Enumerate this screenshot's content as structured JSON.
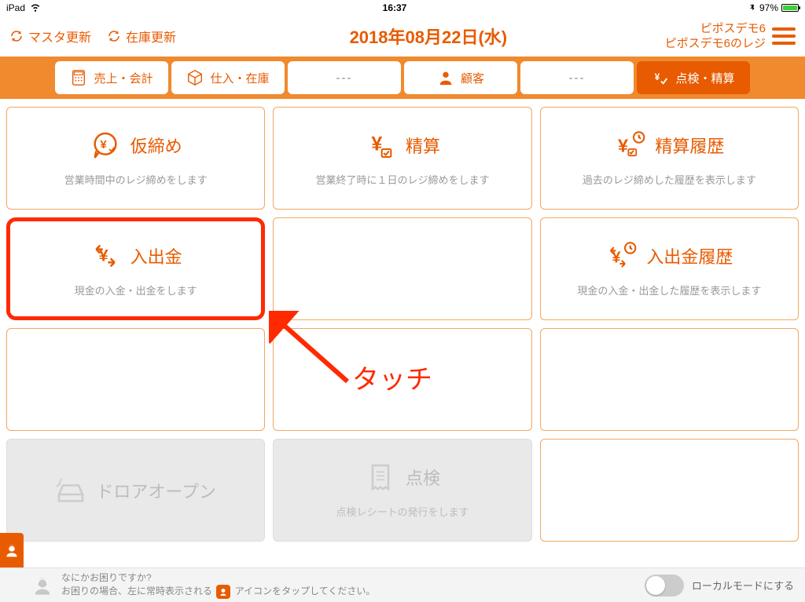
{
  "statusbar": {
    "device": "iPad",
    "time": "16:37",
    "battery_pct": "97%"
  },
  "header": {
    "refresh_master": "マスタ更新",
    "refresh_stock": "在庫更新",
    "date": "2018年08月22日(水)",
    "user_line1": "ピポスデモ6",
    "user_line2": "ピポスデモ6のレジ"
  },
  "nav": {
    "sales": "売上・会計",
    "purchase": "仕入・在庫",
    "blank": "---",
    "customer": "顧客",
    "settlement": "点検・精算"
  },
  "tiles": {
    "karishime": {
      "title": "仮締め",
      "desc": "営業時間中のレジ締めをします"
    },
    "seisan": {
      "title": "精算",
      "desc": "営業終了時に１日のレジ締めをします"
    },
    "seisan_history": {
      "title": "精算履歴",
      "desc": "過去のレジ締めした履歴を表示します"
    },
    "nyushukkin": {
      "title": "入出金",
      "desc": "現金の入金・出金をします"
    },
    "nyushukkin_history": {
      "title": "入出金履歴",
      "desc": "現金の入金・出金した履歴を表示します"
    },
    "drawer_open": {
      "title": "ドロアオープン",
      "desc": ""
    },
    "tenken": {
      "title": "点検",
      "desc": "点検レシートの発行をします"
    }
  },
  "annotation": "タッチ",
  "footer": {
    "line1": "なにかお困りですか?",
    "line2a": "お困りの場合、左に常時表示される",
    "line2b": "アイコンをタップしてください。",
    "toggle_label": "ローカルモードにする"
  }
}
